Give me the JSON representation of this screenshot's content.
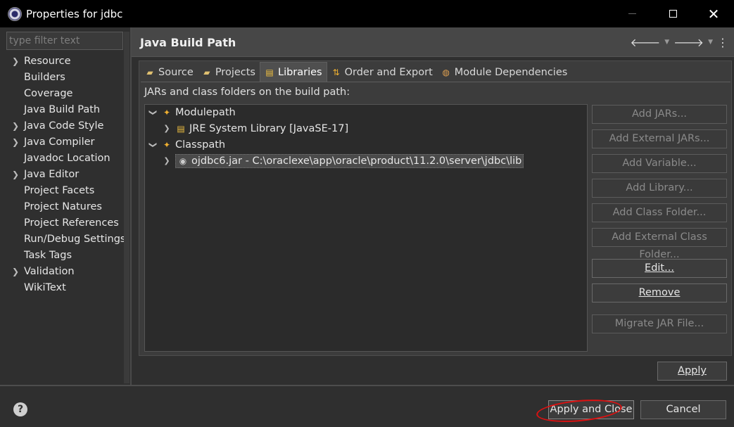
{
  "window": {
    "title": "Properties for jdbc"
  },
  "filter": {
    "placeholder": "type filter text"
  },
  "nav": {
    "items": [
      {
        "label": "Resource",
        "expandable": true
      },
      {
        "label": "Builders",
        "expandable": false
      },
      {
        "label": "Coverage",
        "expandable": false
      },
      {
        "label": "Java Build Path",
        "expandable": false
      },
      {
        "label": "Java Code Style",
        "expandable": true
      },
      {
        "label": "Java Compiler",
        "expandable": true
      },
      {
        "label": "Javadoc Location",
        "expandable": false
      },
      {
        "label": "Java Editor",
        "expandable": true
      },
      {
        "label": "Project Facets",
        "expandable": false
      },
      {
        "label": "Project Natures",
        "expandable": false
      },
      {
        "label": "Project References",
        "expandable": false
      },
      {
        "label": "Run/Debug Settings",
        "expandable": false
      },
      {
        "label": "Task Tags",
        "expandable": false
      },
      {
        "label": "Validation",
        "expandable": true
      },
      {
        "label": "WikiText",
        "expandable": false
      }
    ]
  },
  "page": {
    "title": "Java Build Path"
  },
  "tabs": [
    {
      "label": "Source"
    },
    {
      "label": "Projects"
    },
    {
      "label": "Libraries"
    },
    {
      "label": "Order and Export"
    },
    {
      "label": "Module Dependencies"
    }
  ],
  "build_path_label": "JARs and class folders on the build path:",
  "tree": {
    "modulepath": "Modulepath",
    "jre": "JRE System Library [JavaSE-17]",
    "classpath": "Classpath",
    "jar": "ojdbc6.jar - C:\\oraclexe\\app\\oracle\\product\\11.2.0\\server\\jdbc\\lib"
  },
  "side_buttons": {
    "add_jars": "Add JARs...",
    "add_external_jars": "Add External JARs...",
    "add_variable": "Add Variable...",
    "add_library": "Add Library...",
    "add_class_folder": "Add Class Folder...",
    "add_external_class_folder": "Add External Class Folder...",
    "edit": "Edit...",
    "remove": "Remove",
    "migrate_jar": "Migrate JAR File..."
  },
  "apply_label": "Apply",
  "footer": {
    "apply_and_close": "Apply and Close",
    "cancel": "Cancel"
  },
  "icons": {
    "app": "eclipse-settings-icon",
    "help": "help-icon"
  }
}
